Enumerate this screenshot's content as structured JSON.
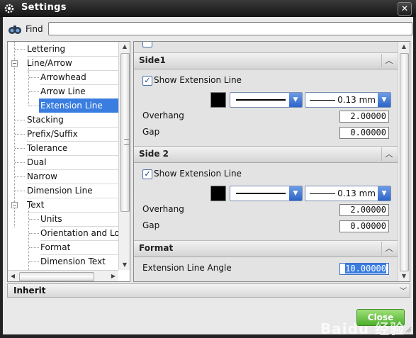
{
  "window": {
    "title": "Settings",
    "close_glyph": "✕"
  },
  "find": {
    "label": "Find",
    "value": ""
  },
  "tree": {
    "items": [
      {
        "label": "Lettering",
        "level": 1
      },
      {
        "label": "Line/Arrow",
        "level": 0,
        "expanded": true
      },
      {
        "label": "Arrowhead",
        "level": 2
      },
      {
        "label": "Arrow Line",
        "level": 2
      },
      {
        "label": "Extension Line",
        "level": 2,
        "selected": true
      },
      {
        "label": "Stacking",
        "level": 1
      },
      {
        "label": "Prefix/Suffix",
        "level": 1
      },
      {
        "label": "Tolerance",
        "level": 1
      },
      {
        "label": "Dual",
        "level": 1
      },
      {
        "label": "Narrow",
        "level": 1
      },
      {
        "label": "Dimension Line",
        "level": 1
      },
      {
        "label": "Text",
        "level": 0,
        "expanded": true
      },
      {
        "label": "Units",
        "level": 2
      },
      {
        "label": "Orientation and Loc",
        "level": 2
      },
      {
        "label": "Format",
        "level": 2
      },
      {
        "label": "Dimension Text",
        "level": 2
      }
    ]
  },
  "sections": {
    "side1": {
      "title": "Side1",
      "show_extension_line": {
        "label": "Show Extension Line",
        "checked": true
      },
      "color": "#000000",
      "line_width": "0.13 mm",
      "overhang": {
        "label": "Overhang",
        "value": "2.00000"
      },
      "gap": {
        "label": "Gap",
        "value": "0.00000"
      }
    },
    "side2": {
      "title": "Side 2",
      "show_extension_line": {
        "label": "Show Extension Line",
        "checked": true
      },
      "color": "#000000",
      "line_width": "0.13 mm",
      "overhang": {
        "label": "Overhang",
        "value": "2.00000"
      },
      "gap": {
        "label": "Gap",
        "value": "0.00000"
      }
    },
    "format": {
      "title": "Format",
      "extension_line_angle": {
        "label": "Extension Line Angle",
        "value": "10.00000"
      }
    }
  },
  "inherit": {
    "label": "Inherit"
  },
  "buttons": {
    "close": "Close"
  },
  "watermark": {
    "text": "Baidu 经验"
  },
  "colors": {
    "accent": "#3a7de0",
    "close_button": "#4caf2b"
  }
}
